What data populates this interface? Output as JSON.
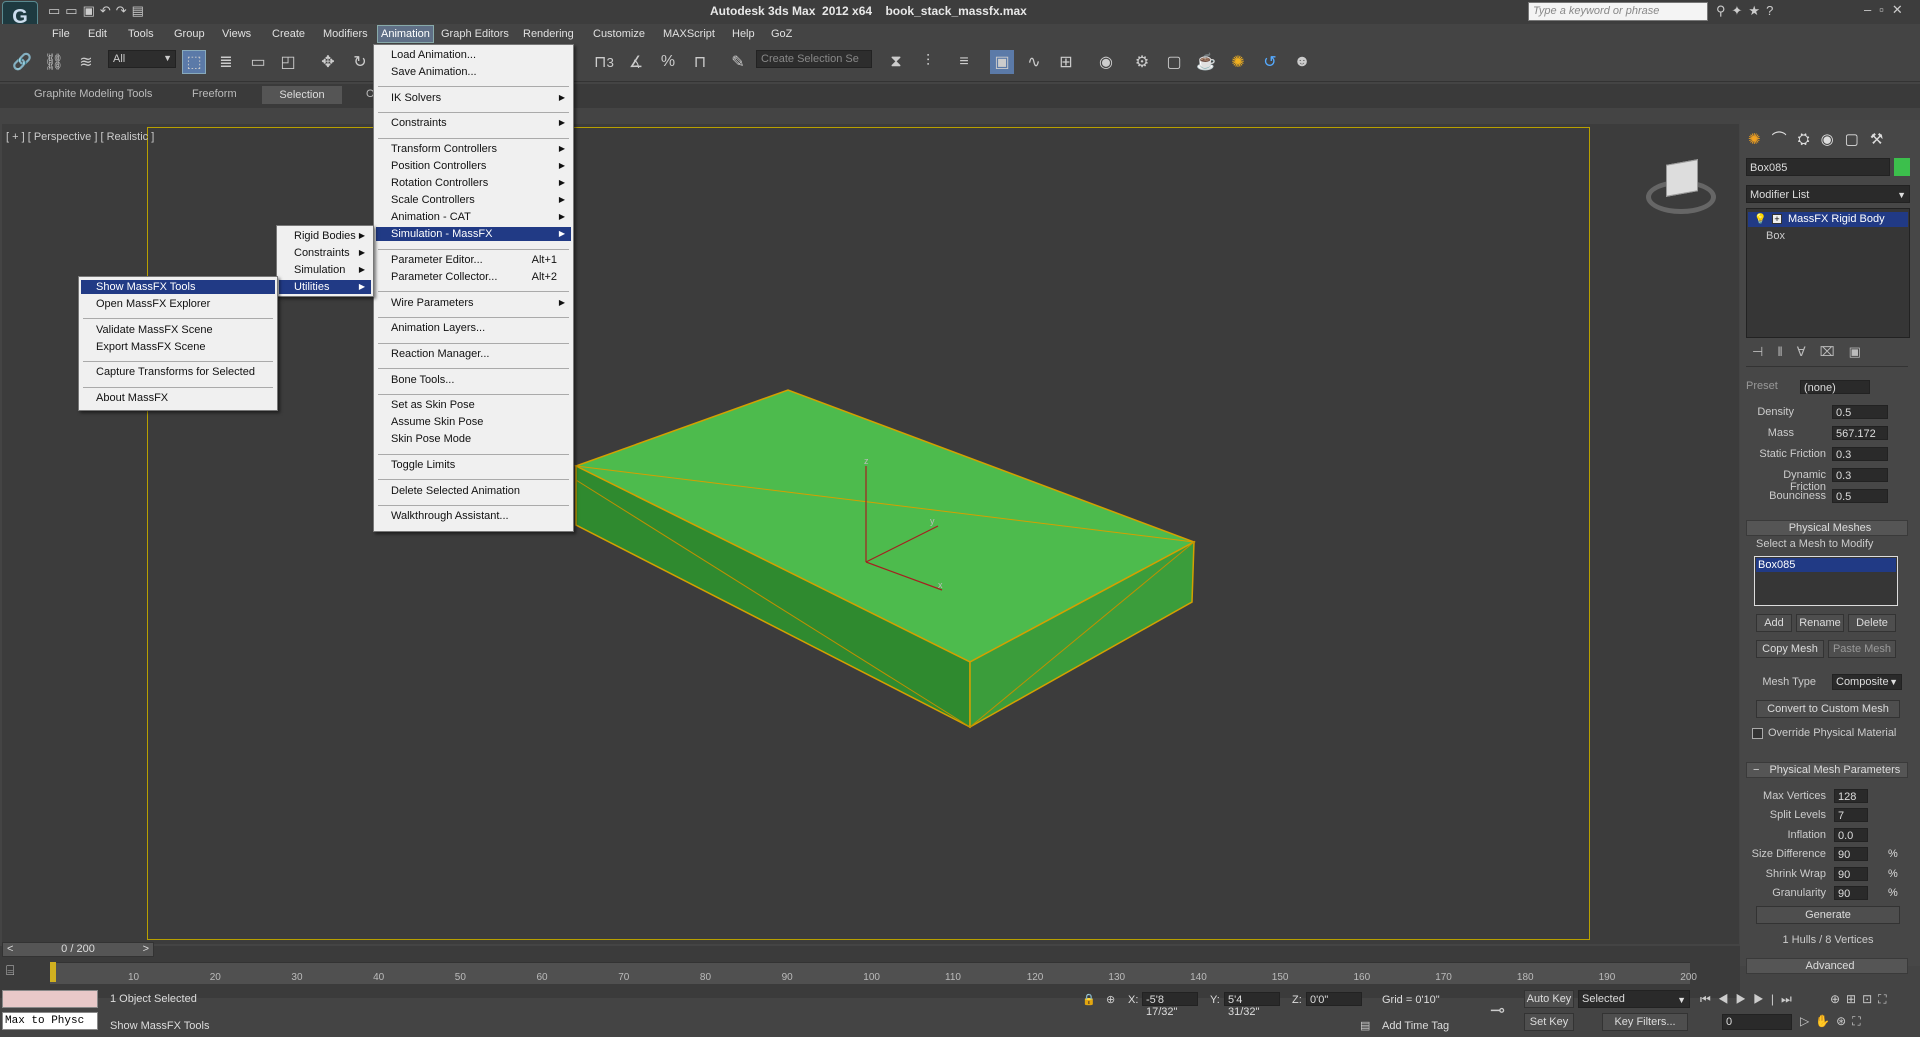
{
  "title_bar": {
    "app": "Autodesk 3ds Max  2012 x64",
    "file": "book_stack_massfx.max",
    "search_placeholder": "Type a keyword or phrase"
  },
  "menubar": [
    "File",
    "Edit",
    "Tools",
    "Group",
    "Views",
    "Create",
    "Modifiers",
    "Animation",
    "Graph Editors",
    "Rendering",
    "Customize",
    "MAXScript",
    "Help",
    "GoZ"
  ],
  "toolbar": {
    "selection_filter": "All",
    "named_selection": "Create Selection Se",
    "snap_labels": [
      "3",
      "%"
    ]
  },
  "ribbon": {
    "tabs": [
      "Graphite Modeling Tools",
      "Freeform",
      "Selection",
      "O"
    ]
  },
  "viewport": {
    "label": "[ + ] [ Perspective ] [ Realistic ]",
    "axes": {
      "x": "x",
      "y": "y",
      "z": "z"
    }
  },
  "animation_menu": [
    {
      "label": "Load Animation..."
    },
    {
      "label": "Save Animation..."
    },
    {
      "sep": true
    },
    {
      "label": "IK Solvers",
      "sub": true
    },
    {
      "sep": true
    },
    {
      "label": "Constraints",
      "sub": true
    },
    {
      "sep": true
    },
    {
      "label": "Transform Controllers",
      "sub": true
    },
    {
      "label": "Position Controllers",
      "sub": true
    },
    {
      "label": "Rotation Controllers",
      "sub": true
    },
    {
      "label": "Scale Controllers",
      "sub": true
    },
    {
      "label": "Animation - CAT",
      "sub": true
    },
    {
      "label": "Simulation - MassFX",
      "sub": true,
      "hl": true
    },
    {
      "sep": true
    },
    {
      "label": "Parameter Editor...",
      "sc": "Alt+1"
    },
    {
      "label": "Parameter Collector...",
      "sc": "Alt+2"
    },
    {
      "sep": true
    },
    {
      "label": "Wire Parameters",
      "sub": true
    },
    {
      "sep": true
    },
    {
      "label": "Animation Layers..."
    },
    {
      "sep": true
    },
    {
      "label": "Reaction Manager..."
    },
    {
      "sep": true
    },
    {
      "label": "Bone Tools..."
    },
    {
      "sep": true
    },
    {
      "label": "Set as Skin Pose"
    },
    {
      "label": "Assume Skin Pose"
    },
    {
      "label": "Skin Pose Mode"
    },
    {
      "sep": true
    },
    {
      "label": "Toggle Limits"
    },
    {
      "sep": true
    },
    {
      "label": "Delete Selected Animation"
    },
    {
      "sep": true
    },
    {
      "label": "Walkthrough Assistant..."
    }
  ],
  "massfx_menu": [
    {
      "label": "Rigid Bodies",
      "sub": true
    },
    {
      "label": "Constraints",
      "sub": true
    },
    {
      "label": "Simulation",
      "sub": true
    },
    {
      "label": "Utilities",
      "sub": true,
      "hl": true
    }
  ],
  "utilities_menu": [
    {
      "label": "Show MassFX Tools",
      "hl": true
    },
    {
      "label": "Open MassFX Explorer"
    },
    {
      "sep": true
    },
    {
      "label": "Validate MassFX Scene"
    },
    {
      "label": "Export MassFX Scene"
    },
    {
      "sep": true
    },
    {
      "label": "Capture Transforms for Selected"
    },
    {
      "sep": true
    },
    {
      "label": "About MassFX"
    }
  ],
  "command_panel": {
    "object_name": "Box085",
    "modifier_list": "Modifier List",
    "stack": [
      "MassFX Rigid Body",
      "Box"
    ],
    "preset_label": "Preset",
    "preset_value": "(none)",
    "params": [
      {
        "label": "Density",
        "value": "0.5"
      },
      {
        "label": "Mass",
        "value": "567.172"
      },
      {
        "label": "Static Friction",
        "value": "0.3"
      },
      {
        "label": "Dynamic Friction",
        "value": "0.3"
      },
      {
        "label": "Bounciness",
        "value": "0.5"
      }
    ],
    "physical_meshes": {
      "title": "Physical Meshes",
      "hint": "Select a Mesh to Modify",
      "list": [
        "Box085"
      ],
      "buttons": [
        "Add",
        "Rename",
        "Delete"
      ],
      "copy": "Copy Mesh",
      "paste": "Paste Mesh",
      "mesh_type_label": "Mesh Type",
      "mesh_type": "Composite",
      "convert": "Convert to Custom Mesh",
      "override": "Override Physical Material"
    },
    "mesh_params": {
      "title": "Physical Mesh Parameters",
      "rows": [
        {
          "label": "Max Vertices",
          "value": "128",
          "unit": ""
        },
        {
          "label": "Split Levels",
          "value": "7",
          "unit": ""
        },
        {
          "label": "Inflation",
          "value": "0.0",
          "unit": ""
        },
        {
          "label": "Size Difference",
          "value": "90",
          "unit": "%"
        },
        {
          "label": "Shrink Wrap",
          "value": "90",
          "unit": "%"
        },
        {
          "label": "Granularity",
          "value": "90",
          "unit": "%"
        }
      ],
      "generate": "Generate",
      "hulls": "1 Hulls / 8 Vertices"
    },
    "advanced": "Advanced"
  },
  "timeline": {
    "frame": "0 / 200",
    "ticks": [
      "10",
      "20",
      "30",
      "40",
      "50",
      "60",
      "70",
      "80",
      "90",
      "100",
      "110",
      "120",
      "130",
      "140",
      "150",
      "160",
      "170",
      "180",
      "190",
      "200"
    ]
  },
  "status": {
    "script": "Max to Physc",
    "objects": "1 Object Selected",
    "prompt": "Show MassFX Tools",
    "x_label": "X:",
    "x": "-5'8 17/32\"",
    "y_label": "Y:",
    "y": "5'4 31/32\"",
    "z_label": "Z:",
    "z": "0'0\"",
    "grid": "Grid = 0'10\"",
    "auto_key": "Auto Key",
    "set_key": "Set Key",
    "key_mode": "Selected",
    "key_filters": "Key Filters...",
    "add_time_tag": "Add Time Tag",
    "frame": "0"
  }
}
